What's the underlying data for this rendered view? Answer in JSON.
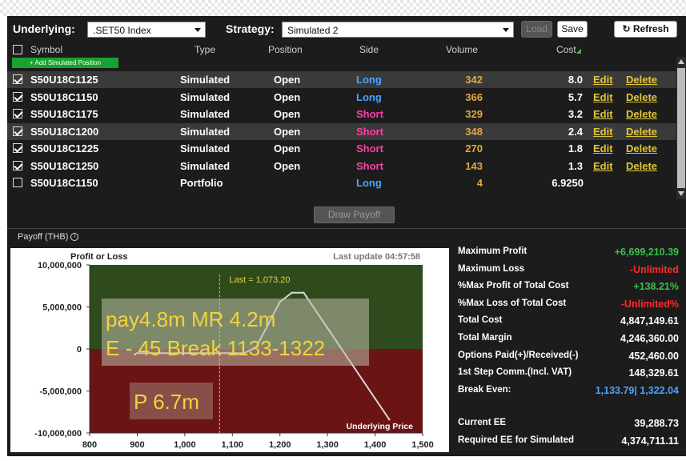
{
  "toolbar": {
    "underlying_label": "Underlying:",
    "underlying_value": ".SET50 Index",
    "strategy_label": "Strategy:",
    "strategy_value": "Simulated 2",
    "load_label": "Load",
    "save_label": "Save",
    "refresh_label": "Refresh"
  },
  "table": {
    "headers": {
      "symbol": "Symbol",
      "type": "Type",
      "position": "Position",
      "side": "Side",
      "volume": "Volume",
      "cost": "Cost"
    },
    "add_button": "+ Add Simulated Position",
    "edit_label": "Edit",
    "delete_label": "Delete",
    "rows": [
      {
        "checked": true,
        "symbol": "S50U18C1125",
        "type": "Simulated",
        "position": "Open",
        "side": "Long",
        "volume": "342",
        "cost": "8.0",
        "highlight": true
      },
      {
        "checked": true,
        "symbol": "S50U18C1150",
        "type": "Simulated",
        "position": "Open",
        "side": "Long",
        "volume": "366",
        "cost": "5.7",
        "highlight": false
      },
      {
        "checked": true,
        "symbol": "S50U18C1175",
        "type": "Simulated",
        "position": "Open",
        "side": "Short",
        "volume": "329",
        "cost": "3.2",
        "highlight": false
      },
      {
        "checked": true,
        "symbol": "S50U18C1200",
        "type": "Simulated",
        "position": "Open",
        "side": "Short",
        "volume": "348",
        "cost": "2.4",
        "highlight": true
      },
      {
        "checked": true,
        "symbol": "S50U18C1225",
        "type": "Simulated",
        "position": "Open",
        "side": "Short",
        "volume": "270",
        "cost": "1.8",
        "highlight": false
      },
      {
        "checked": true,
        "symbol": "S50U18C1250",
        "type": "Simulated",
        "position": "Open",
        "side": "Short",
        "volume": "143",
        "cost": "1.3",
        "highlight": false
      },
      {
        "checked": false,
        "symbol": "S50U18C1150",
        "type": "Portfolio",
        "position": "",
        "side": "Long",
        "volume": "4",
        "cost": "6.9250",
        "highlight": false
      }
    ]
  },
  "draw_payoff_label": "Draw Payoff",
  "payoff_title": "Payoff (THB)",
  "chart_data": {
    "type": "line",
    "ylabel": "Profit or Loss",
    "xlabel": "Underlying Price",
    "last_update": "Last update 04:57:58",
    "last_label": "Last = 1,073.20",
    "last_x": 1073.2,
    "xlim": [
      800,
      1500
    ],
    "ylim": [
      -10000000,
      10000000
    ],
    "x_ticks": [
      "800",
      "900",
      "1,000",
      "1,100",
      "1,200",
      "1,300",
      "1,400",
      "1,500"
    ],
    "y_ticks": [
      "10,000,000",
      "5,000,000",
      "0",
      "-5,000,000",
      "-10,000,000"
    ],
    "series": [
      {
        "x": [
          900,
          1125,
          1150,
          1175,
          1200,
          1225,
          1250,
          1300,
          1400,
          1430
        ],
        "y": [
          -500000,
          -500000,
          200000,
          2900000,
          5600000,
          6700000,
          6700000,
          2500000,
          -5900000,
          -8400000
        ]
      }
    ]
  },
  "annotations": [
    "pay4.8m MR 4.2m",
    "E -.45 Break 1133-1322",
    "P 6.7m"
  ],
  "stats": [
    {
      "label": "Maximum Profit",
      "value": "+6,699,210.39",
      "color": "green"
    },
    {
      "label": "Maximum Loss",
      "value": "-Unlimited",
      "color": "red"
    },
    {
      "label": "%Max Profit of Total Cost",
      "value": "+138.21%",
      "color": "green"
    },
    {
      "label": "%Max Loss of Total Cost",
      "value": "-Unlimited%",
      "color": "red"
    },
    {
      "label": "Total Cost",
      "value": "4,847,149.61",
      "color": "white"
    },
    {
      "label": "Total Margin",
      "value": "4,246,360.00",
      "color": "white"
    },
    {
      "label": "Options Paid(+)/Received(-)",
      "value": "452,460.00",
      "color": "white"
    },
    {
      "label": "1st Step Comm.(Incl. VAT)",
      "value": "148,329.61",
      "color": "white"
    },
    {
      "label": "Break Even:",
      "value": "1,133.79| 1,322.04",
      "color": "blue"
    }
  ],
  "ee": [
    {
      "label": "Current EE",
      "value": "39,288.73"
    },
    {
      "label": "Required EE for Simulated",
      "value": "4,374,711.11"
    }
  ]
}
